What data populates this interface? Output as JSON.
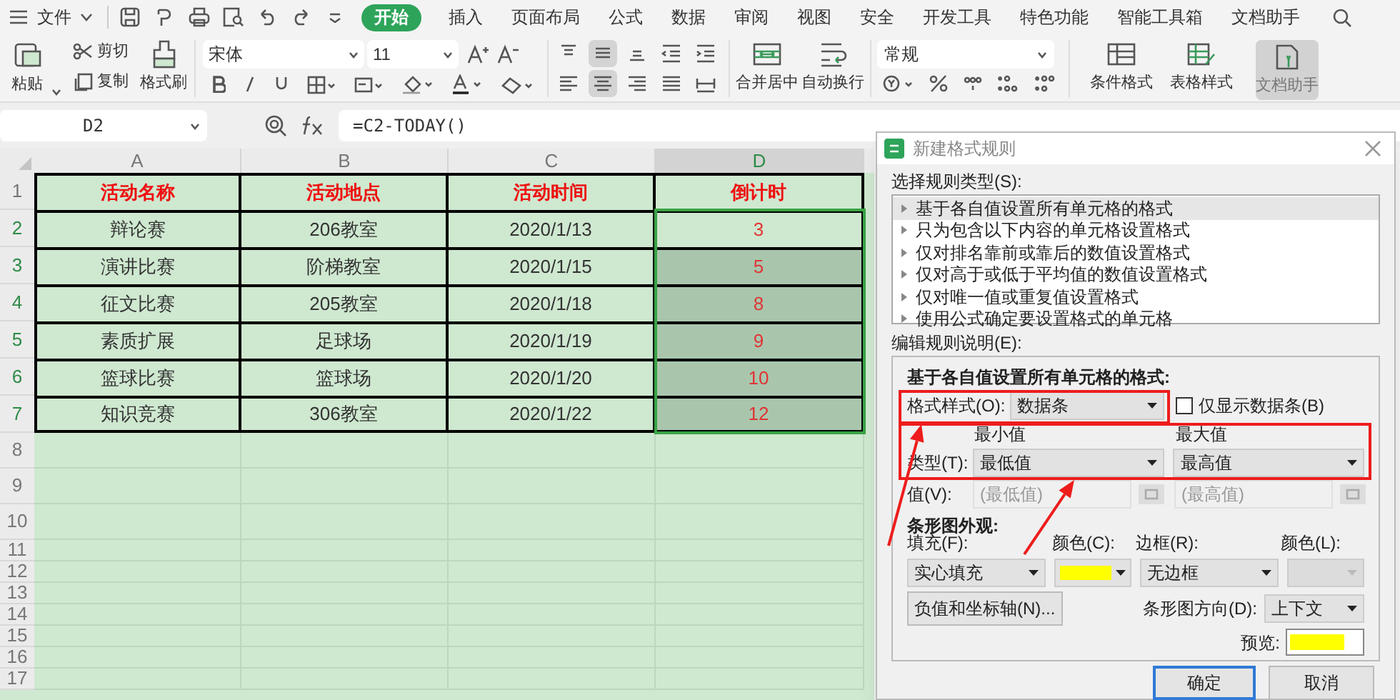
{
  "menu_bar": {
    "file_menu": "文件",
    "tabs": [
      {
        "label": "开始",
        "selected": true
      },
      {
        "label": "插入",
        "selected": false
      },
      {
        "label": "页面布局",
        "selected": false
      },
      {
        "label": "公式",
        "selected": false
      },
      {
        "label": "数据",
        "selected": false
      },
      {
        "label": "审阅",
        "selected": false
      },
      {
        "label": "视图",
        "selected": false
      },
      {
        "label": "安全",
        "selected": false
      },
      {
        "label": "开发工具",
        "selected": false
      },
      {
        "label": "特色功能",
        "selected": false
      },
      {
        "label": "智能工具箱",
        "selected": false
      },
      {
        "label": "文档助手",
        "selected": false
      }
    ]
  },
  "ribbon": {
    "paste": "粘贴",
    "cut": "剪切",
    "copy": "复制",
    "format_painter": "格式刷",
    "font_name": "宋体",
    "font_size": "11",
    "merge_center": "合并居中",
    "wrap_text": "自动换行",
    "number_format": "常规",
    "conditional_format": "条件格式",
    "table_style": "表格样式",
    "doc_assistant": {
      "label": "文档助手",
      "selected": true
    }
  },
  "formula_bar": {
    "name_box": "D2",
    "formula": "=C2-TODAY()"
  },
  "sheet": {
    "columns": [
      {
        "label": "A",
        "selected": false
      },
      {
        "label": "B",
        "selected": false
      },
      {
        "label": "C",
        "selected": false
      },
      {
        "label": "D",
        "selected": true
      }
    ],
    "header_row": {
      "number": "1",
      "cells": [
        "活动名称",
        "活动地点",
        "活动时间",
        "倒计时"
      ]
    },
    "rows": [
      {
        "number": "2",
        "selected": true,
        "active": true,
        "cells": [
          "辩论赛",
          "206教室",
          "2020/1/13",
          "3"
        ]
      },
      {
        "number": "3",
        "selected": true,
        "active": false,
        "cells": [
          "演讲比赛",
          "阶梯教室",
          "2020/1/15",
          "5"
        ]
      },
      {
        "number": "4",
        "selected": true,
        "active": false,
        "cells": [
          "征文比赛",
          "205教室",
          "2020/1/18",
          "8"
        ]
      },
      {
        "number": "5",
        "selected": true,
        "active": false,
        "cells": [
          "素质扩展",
          "足球场",
          "2020/1/19",
          "9"
        ]
      },
      {
        "number": "6",
        "selected": true,
        "active": false,
        "cells": [
          "篮球比赛",
          "篮球场",
          "2020/1/20",
          "10"
        ]
      },
      {
        "number": "7",
        "selected": true,
        "active": false,
        "cells": [
          "知识竞赛",
          "306教室",
          "2020/1/22",
          "12"
        ]
      }
    ],
    "empty_rows": [
      "8",
      "9",
      "10",
      "11",
      "12",
      "13",
      "14",
      "15",
      "16",
      "17"
    ]
  },
  "dialog": {
    "title": "新建格式规则",
    "rule_type_label": "选择规则类型(S):",
    "rule_types": [
      {
        "label": "基于各自值设置所有单元格的格式",
        "selected": true
      },
      {
        "label": "只为包含以下内容的单元格设置格式",
        "selected": false
      },
      {
        "label": "仅对排名靠前或靠后的数值设置格式",
        "selected": false
      },
      {
        "label": "仅对高于或低于平均值的数值设置格式",
        "selected": false
      },
      {
        "label": "仅对唯一值或重复值设置格式",
        "selected": false
      },
      {
        "label": "使用公式确定要设置格式的单元格",
        "selected": false
      }
    ],
    "edit_label": "编辑规则说明(E):",
    "panel_heading": "基于各自值设置所有单元格的格式:",
    "format_style_label": "格式样式(O):",
    "format_style": "数据条",
    "bar_only": {
      "label": "仅显示数据条(B)",
      "checked": false
    },
    "min_label": "最小值",
    "max_label": "最大值",
    "type_label": "类型(T):",
    "min_type": "最低值",
    "max_type": "最高值",
    "value_label": "值(V):",
    "min_value": {
      "placeholder": "(最低值)",
      "disabled": true
    },
    "max_value": {
      "placeholder": "(最高值)",
      "disabled": true
    },
    "appearance_heading": "条形图外观:",
    "fill_label": "填充(F):",
    "fill": "实心填充",
    "color_label": "颜色(C):",
    "fill_color": {
      "color": "#ffff00"
    },
    "border_label": "边框(R):",
    "border": "无边框",
    "border_color_label": "颜色(L):",
    "border_color_disabled": true,
    "axis_button": "负值和坐标轴(N)...",
    "direction_label": "条形图方向(D):",
    "direction": "上下文",
    "preview_label": "预览:",
    "ok": "确定",
    "cancel": "取消"
  }
}
